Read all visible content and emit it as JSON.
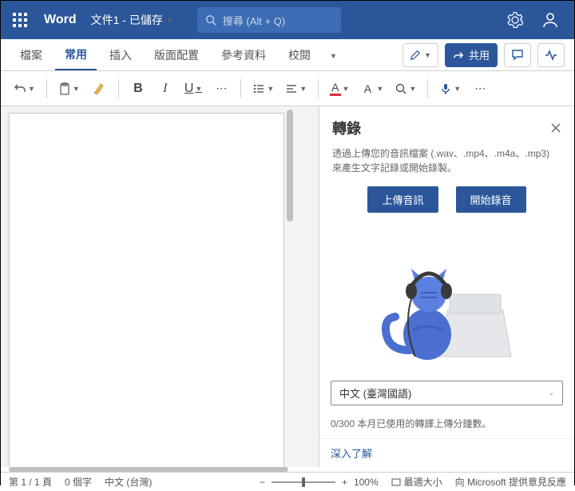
{
  "titlebar": {
    "app_name": "Word",
    "doc_title": "文件1 - 已儲存",
    "search_placeholder": "搜尋 (Alt + Q)"
  },
  "tabs": {
    "file": "檔案",
    "home": "常用",
    "insert": "插入",
    "layout": "版面配置",
    "references": "參考資料",
    "review": "校閱"
  },
  "ribbon_right": {
    "share": "共用"
  },
  "toolbar": {
    "bold": "B",
    "italic": "I",
    "underline": "U",
    "font_color_letter": "A",
    "highlight_letter": "A"
  },
  "pane": {
    "title": "轉錄",
    "description": "透過上傳您的音訊檔案 (.wav、.mp4、.m4a、.mp3) 來產生文字記錄或開始錄製。",
    "upload_btn": "上傳音訊",
    "record_btn": "開始錄音",
    "lang_selected": "中文 (臺灣國語)",
    "usage_text": "0/300 本月已使用的轉譯上傳分鐘數。",
    "learn_more": "深入了解"
  },
  "statusbar": {
    "page": "第 1 / 1 頁",
    "words": "0 個字",
    "lang": "中文 (台灣)",
    "zoom": "100%",
    "fit": "最適大小",
    "feedback": "向 Microsoft 提供意見反應"
  }
}
